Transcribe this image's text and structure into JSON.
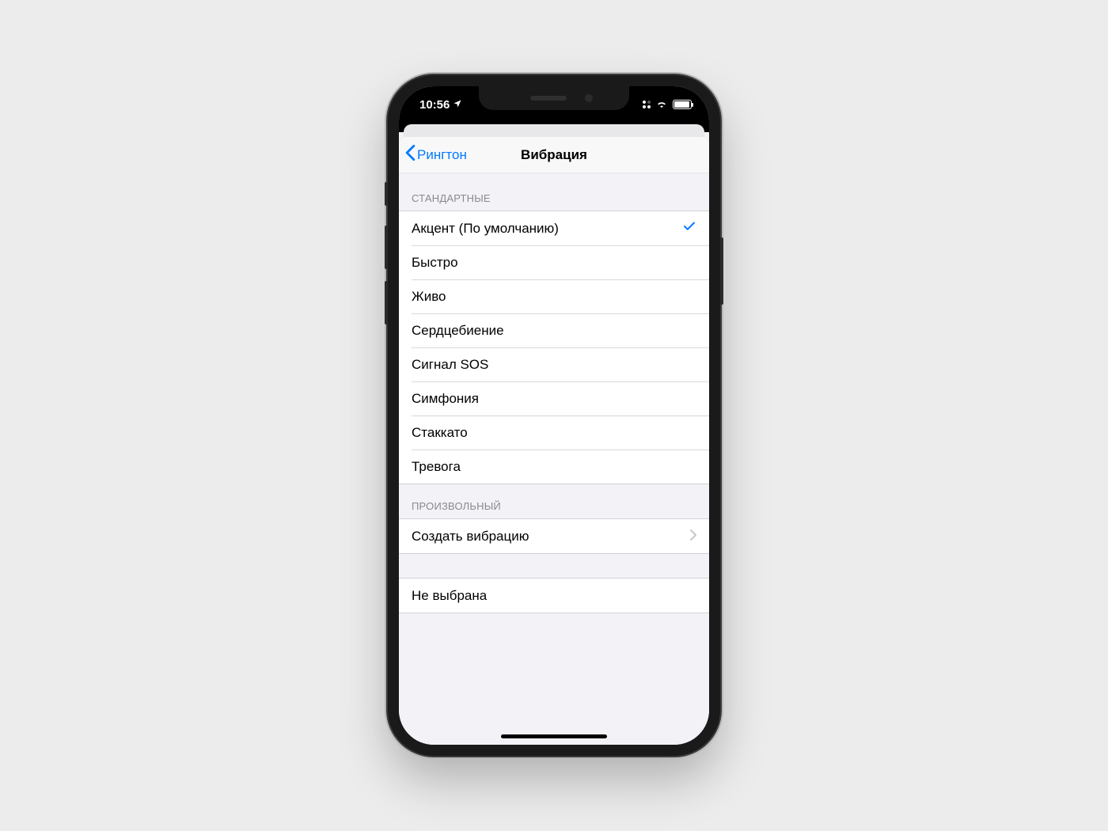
{
  "statusbar": {
    "time": "10:56"
  },
  "navbar": {
    "back_label": "Рингтон",
    "title": "Вибрация"
  },
  "sections": {
    "standard_header": "СТАНДАРТНЫЕ",
    "standard_items": [
      {
        "label": "Акцент (По умолчанию)",
        "selected": true
      },
      {
        "label": "Быстро"
      },
      {
        "label": "Живо"
      },
      {
        "label": "Сердцебиение"
      },
      {
        "label": "Сигнал SOS"
      },
      {
        "label": "Симфония"
      },
      {
        "label": "Стаккато"
      },
      {
        "label": "Тревога"
      }
    ],
    "custom_header": "ПРОИЗВОЛЬНЫЙ",
    "create_label": "Создать вибрацию",
    "none_label": "Не выбрана"
  }
}
